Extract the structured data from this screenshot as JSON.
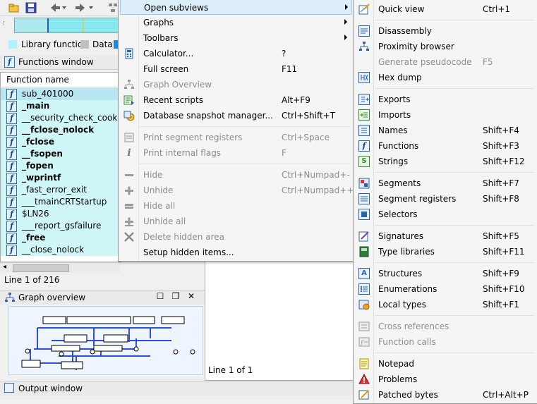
{
  "background": {
    "legend": [
      {
        "label": "Library function",
        "color": "#aef4ff"
      },
      {
        "label": "Data",
        "color": "#c0c0c0"
      }
    ],
    "functions_window": {
      "title": "Functions window",
      "column_header": "Function name",
      "rows": [
        {
          "name": "sub_401000",
          "bold": false,
          "selected": true
        },
        {
          "name": "_main",
          "bold": true
        },
        {
          "name": "__security_check_cookie(x)",
          "bold": false
        },
        {
          "name": "__fclose_nolock",
          "bold": true
        },
        {
          "name": "_fclose",
          "bold": true
        },
        {
          "name": "__fsopen",
          "bold": true
        },
        {
          "name": "_fopen",
          "bold": true
        },
        {
          "name": "_wprintf",
          "bold": true
        },
        {
          "name": "_fast_error_exit",
          "bold": false
        },
        {
          "name": "___tmainCRTStartup",
          "bold": false
        },
        {
          "name": "$LN26",
          "bold": false
        },
        {
          "name": "___report_gsfailure",
          "bold": false
        },
        {
          "name": "_free",
          "bold": true
        },
        {
          "name": "__close_nolock",
          "bold": false
        }
      ],
      "status": "Line 1 of 216"
    },
    "graph_overview": {
      "title": "Graph overview"
    },
    "center_status": "Line 1 of 1",
    "output_window": {
      "title": "Output window"
    }
  },
  "view_menu": {
    "items": [
      {
        "label": "Open subviews",
        "shortcut": "",
        "submenu": true,
        "highlighted": true,
        "disabled": false,
        "icon": ""
      },
      {
        "label": "Graphs",
        "shortcut": "",
        "submenu": true,
        "disabled": false,
        "icon": ""
      },
      {
        "label": "Toolbars",
        "shortcut": "",
        "submenu": true,
        "disabled": false,
        "icon": ""
      },
      {
        "label": "Calculator...",
        "shortcut": "?",
        "disabled": false,
        "icon": "calculator-icon"
      },
      {
        "label": "Full screen",
        "shortcut": "F11",
        "disabled": false,
        "icon": ""
      },
      {
        "label": "Graph Overview",
        "shortcut": "",
        "disabled": true,
        "icon": "graph-overview-icon"
      },
      {
        "label": "Recent scripts",
        "shortcut": "Alt+F9",
        "disabled": false,
        "icon": "recent-scripts-icon"
      },
      {
        "label": "Database snapshot manager...",
        "shortcut": "Ctrl+Shift+T",
        "disabled": false,
        "icon": "snapshot-icon"
      },
      {
        "label": "Print segment registers",
        "shortcut": "Ctrl+Space",
        "disabled": true,
        "icon": "segment-registers-icon"
      },
      {
        "label": "Print internal flags",
        "shortcut": "F",
        "disabled": true,
        "icon": "info-icon"
      },
      {
        "label": "Hide",
        "shortcut": "Ctrl+Numpad+-",
        "disabled": true,
        "icon": "minus-icon"
      },
      {
        "label": "Unhide",
        "shortcut": "Ctrl+Numpad++",
        "disabled": true,
        "icon": "plus-icon"
      },
      {
        "label": "Hide all",
        "shortcut": "",
        "disabled": true,
        "icon": "minus-icon"
      },
      {
        "label": "Unhide all",
        "shortcut": "",
        "disabled": true,
        "icon": "plus-icon"
      },
      {
        "label": "Delete hidden area",
        "shortcut": "",
        "disabled": true,
        "icon": "delete-icon"
      },
      {
        "label": "Setup hidden items...",
        "shortcut": "",
        "disabled": false,
        "icon": ""
      }
    ]
  },
  "subviews_menu": {
    "items": [
      {
        "label": "Quick view",
        "shortcut": "Ctrl+1",
        "disabled": false,
        "icon": "quick-view-icon"
      },
      {
        "label": "Disassembly",
        "shortcut": "",
        "disabled": false,
        "icon": "disassembly-icon"
      },
      {
        "label": "Proximity browser",
        "shortcut": "",
        "disabled": false,
        "icon": "proximity-icon"
      },
      {
        "label": "Generate pseudocode",
        "shortcut": "F5",
        "disabled": true,
        "icon": ""
      },
      {
        "label": "Hex dump",
        "shortcut": "",
        "disabled": false,
        "icon": "hex-dump-icon"
      },
      {
        "label": "Exports",
        "shortcut": "",
        "disabled": false,
        "icon": "exports-icon"
      },
      {
        "label": "Imports",
        "shortcut": "",
        "disabled": false,
        "icon": "imports-icon"
      },
      {
        "label": "Names",
        "shortcut": "Shift+F4",
        "disabled": false,
        "icon": "names-icon"
      },
      {
        "label": "Functions",
        "shortcut": "Shift+F3",
        "disabled": false,
        "icon": "functions-icon"
      },
      {
        "label": "Strings",
        "shortcut": "Shift+F12",
        "disabled": false,
        "icon": "strings-icon"
      },
      {
        "label": "Segments",
        "shortcut": "Shift+F7",
        "disabled": false,
        "icon": "segments-icon"
      },
      {
        "label": "Segment registers",
        "shortcut": "Shift+F8",
        "disabled": false,
        "icon": "segment-registers-icon"
      },
      {
        "label": "Selectors",
        "shortcut": "",
        "disabled": false,
        "icon": "selectors-icon"
      },
      {
        "label": "Signatures",
        "shortcut": "Shift+F5",
        "disabled": false,
        "icon": "signatures-icon"
      },
      {
        "label": "Type libraries",
        "shortcut": "Shift+F11",
        "disabled": false,
        "icon": "type-libraries-icon"
      },
      {
        "label": "Structures",
        "shortcut": "Shift+F9",
        "disabled": false,
        "icon": "structures-icon"
      },
      {
        "label": "Enumerations",
        "shortcut": "Shift+F10",
        "disabled": false,
        "icon": "enumerations-icon"
      },
      {
        "label": "Local types",
        "shortcut": "Shift+F1",
        "disabled": false,
        "icon": "local-types-icon"
      },
      {
        "label": "Cross references",
        "shortcut": "",
        "disabled": true,
        "icon": "cross-references-icon"
      },
      {
        "label": "Function calls",
        "shortcut": "",
        "disabled": true,
        "icon": "function-calls-icon"
      },
      {
        "label": "Notepad",
        "shortcut": "",
        "disabled": false,
        "icon": "notepad-icon"
      },
      {
        "label": "Problems",
        "shortcut": "",
        "disabled": false,
        "icon": "problems-icon"
      },
      {
        "label": "Patched bytes",
        "shortcut": "Ctrl+Alt+P",
        "disabled": false,
        "icon": "patched-bytes-icon"
      }
    ]
  }
}
